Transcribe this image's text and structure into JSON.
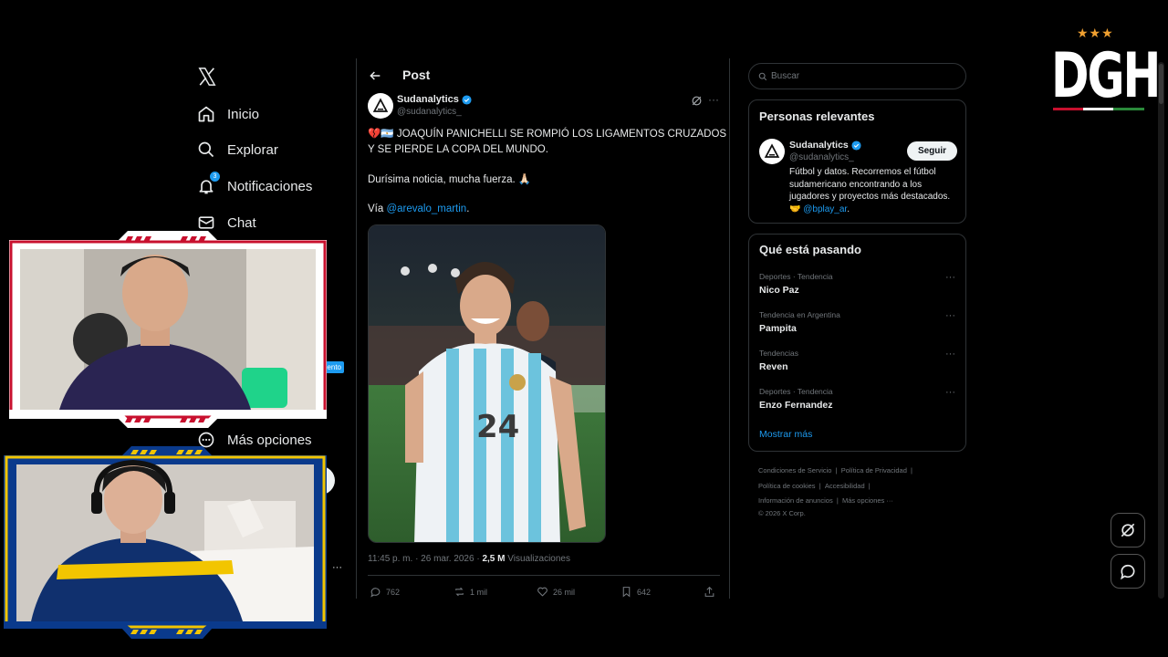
{
  "nav": {
    "items": [
      {
        "label": "Inicio",
        "icon": "home-icon"
      },
      {
        "label": "Explorar",
        "icon": "search-icon"
      },
      {
        "label": "Notificaciones",
        "icon": "bell-icon"
      },
      {
        "label": "Chat",
        "icon": "mail-icon"
      },
      {
        "label": "Más opciones",
        "icon": "more-circle-icon"
      }
    ],
    "notifications_badge": "3",
    "partial_pill": "ento"
  },
  "post": {
    "header_title": "Post",
    "author_name": "Sudanalytics",
    "author_handle": "@sudanalytics_",
    "line1": "💔🇦🇷 JOAQUÍN PANICHELLI SE ROMPIÓ LOS LIGAMENTOS CRUZADOS",
    "line2": "Y SE PIERDE LA COPA DEL MUNDO.",
    "line3": "Durísima noticia, mucha fuerza. 🙏🏻",
    "via_label": "Vía ",
    "via_link": "@arevalo_martin",
    "via_end": ".",
    "jersey_number": "24",
    "timestamp": "11:45 p. m. · 26 mar. 2026 · ",
    "views_count": "2,5 M",
    "views_label": " Visualizaciones",
    "actions": {
      "replies": "762",
      "reposts": "1 mil",
      "likes": "26 mil",
      "bookmarks": "642"
    }
  },
  "right": {
    "search_placeholder": "Buscar",
    "relevant_title": "Personas relevantes",
    "relevant_name": "Sudanalytics",
    "relevant_handle": "@sudanalytics_",
    "follow_label": "Seguir",
    "bio_text": "Fútbol y datos. Recorremos el fútbol sudamericano encontrando a los jugadores y proyectos más destacados. 🤝 ",
    "bio_link": "@bplay_ar",
    "bio_end": ".",
    "trending_title": "Qué está pasando",
    "trends": [
      {
        "category": "Deportes · Tendencia",
        "name": "Nico Paz"
      },
      {
        "category": "Tendencia en Argentina",
        "name": "Pampita"
      },
      {
        "category": "Tendencias",
        "name": "Reven"
      },
      {
        "category": "Deportes · Tendencia",
        "name": "Enzo Fernandez"
      }
    ],
    "show_more": "Mostrar más",
    "footer": {
      "l1": "Condiciones de Servicio",
      "l2": "Política de Privacidad",
      "l3": "Política de cookies",
      "l4": "Accesibilidad",
      "l5": "Información de anuncios",
      "l6": "Más opciones ···",
      "l7": "© 2026 X Corp."
    }
  },
  "overlay": {
    "logo_text": "DGH",
    "logo_stars": "★★★"
  },
  "colors": {
    "accent": "#1d9bf0",
    "background": "#000000",
    "border": "#2f3336",
    "muted": "#71767b",
    "cam1_frame": "#c8102e",
    "cam2_frame": "#0a3a8c",
    "cam2_accent": "#f2c500"
  }
}
